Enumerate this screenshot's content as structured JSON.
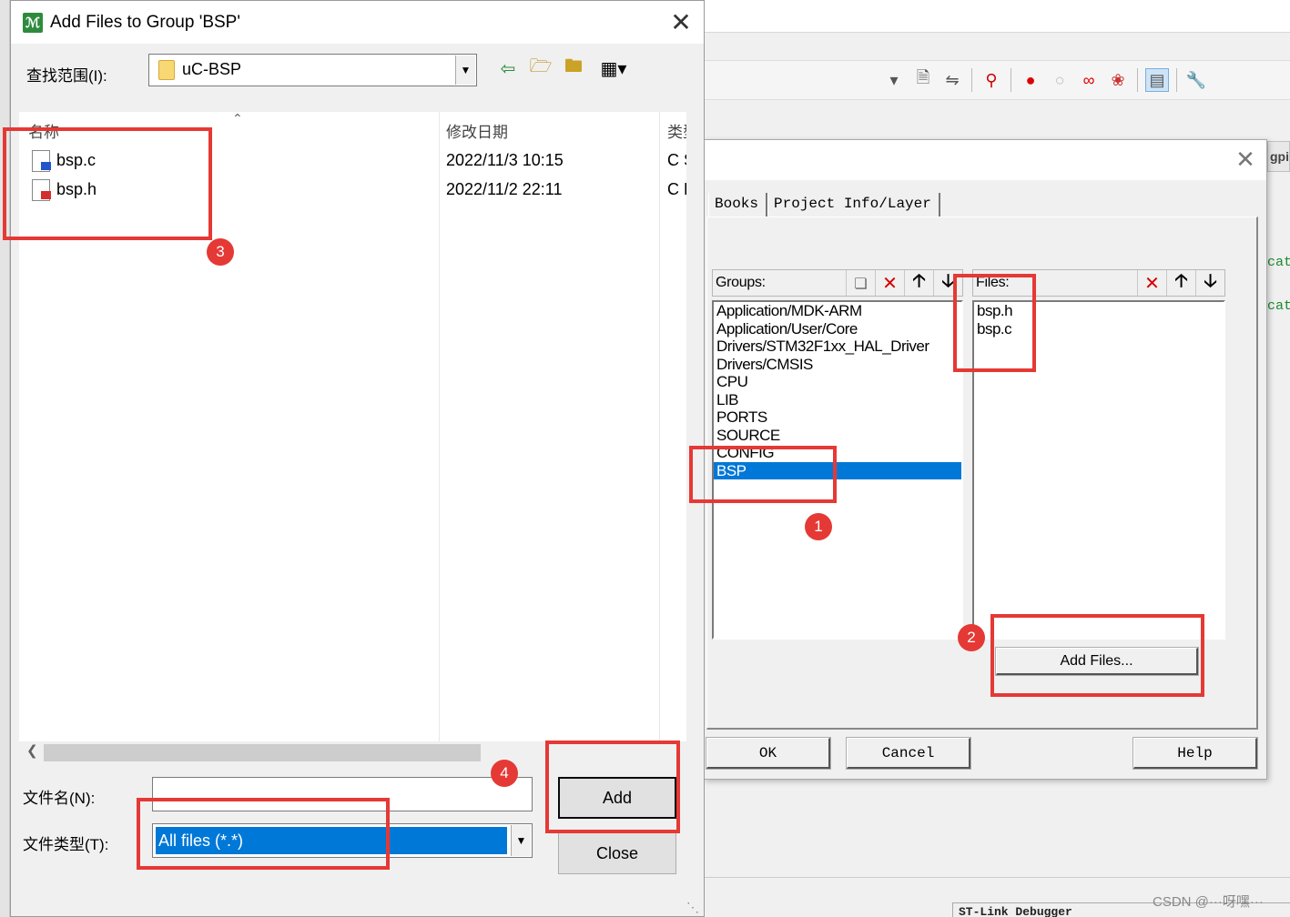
{
  "ide": {
    "right_tab_text": "gpi",
    "code_lines": [
      "cat",
      "cat"
    ],
    "debugger_label": "ST-Link Debugger",
    "watermark": "CSDN @···呀嘿···"
  },
  "project_dialog": {
    "tabs": [
      "Books",
      "Project Info/Layer"
    ],
    "groups_label": "Groups:",
    "files_label": "Files:",
    "groups": [
      "Application/MDK-ARM",
      "Application/User/Core",
      "Drivers/STM32F1xx_HAL_Driver",
      "Drivers/CMSIS",
      "CPU",
      "LIB",
      "PORTS",
      "SOURCE",
      "CONFIG",
      "BSP"
    ],
    "selected_group": "BSP",
    "files": [
      "bsp.h",
      "bsp.c"
    ],
    "add_files_button": "Add Files...",
    "ok_button": "OK",
    "cancel_button": "Cancel",
    "help_button": "Help"
  },
  "file_dialog": {
    "title": "Add Files to Group 'BSP'",
    "look_in_label": "查找范围(I):",
    "look_in_value": "uC-BSP",
    "columns": {
      "name": "名称",
      "date": "修改日期",
      "type": "类型"
    },
    "files": [
      {
        "name": "bsp.c",
        "date": "2022/11/3 10:15",
        "type": "C Source"
      },
      {
        "name": "bsp.h",
        "date": "2022/11/2 22:11",
        "type": "C Header"
      }
    ],
    "file_name_label": "文件名(N):",
    "file_name_value": "",
    "file_type_label": "文件类型(T):",
    "file_type_value": "All files (*.*)",
    "add_button": "Add",
    "close_button": "Close"
  },
  "annotations": [
    "1",
    "2",
    "3",
    "4"
  ],
  "colors": {
    "annotation": "#e53935",
    "selection": "#0078d7"
  }
}
